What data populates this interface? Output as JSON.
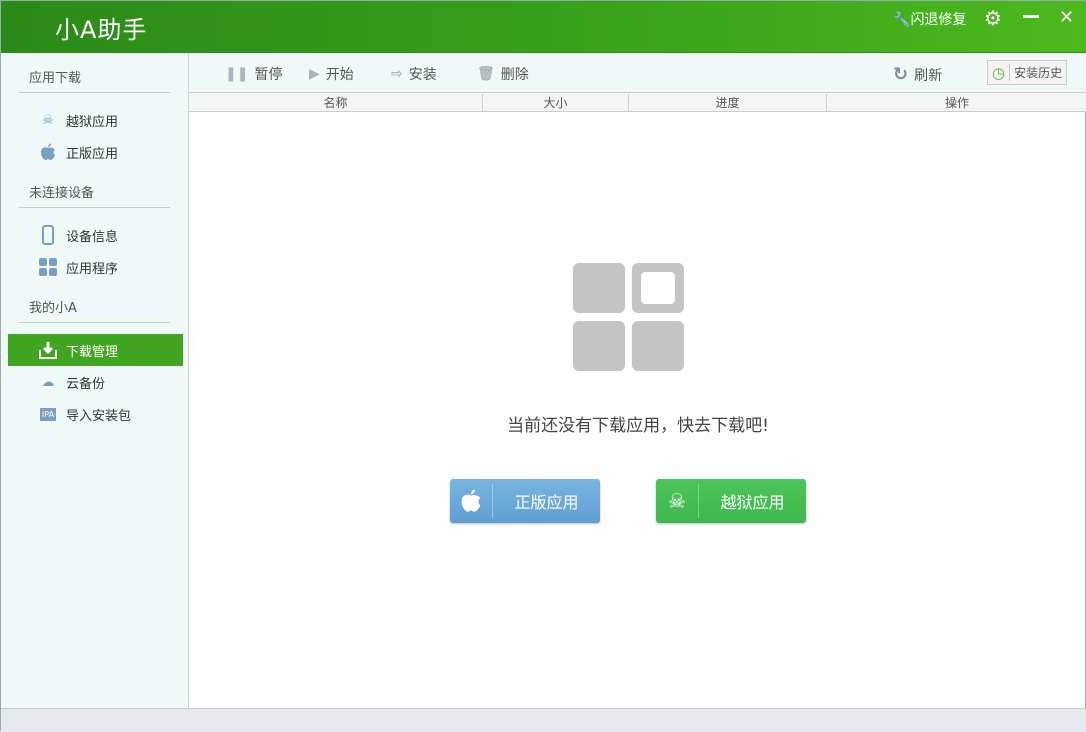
{
  "app": {
    "title": "小A助手",
    "repair": "闪退修复"
  },
  "sidebar": {
    "sections": [
      {
        "label": "应用下载",
        "items": [
          {
            "label": "越狱应用",
            "icon": "jailbreak-apple-icon"
          },
          {
            "label": "正版应用",
            "icon": "apple-icon"
          }
        ]
      },
      {
        "label": "未连接设备",
        "items": [
          {
            "label": "设备信息",
            "icon": "phone-icon"
          },
          {
            "label": "应用程序",
            "icon": "apps-grid-icon"
          }
        ]
      },
      {
        "label": "我的小A",
        "items": [
          {
            "label": "下载管理",
            "icon": "download-icon",
            "active": true
          },
          {
            "label": "云备份",
            "icon": "cloud-upload-icon"
          },
          {
            "label": "导入安装包",
            "icon": "ipa-icon",
            "badge": "IPA"
          }
        ]
      }
    ]
  },
  "toolbar": {
    "pause": "暂停",
    "start": "开始",
    "install": "安装",
    "delete": "删除",
    "refresh": "刷新",
    "history": "安装历史"
  },
  "table": {
    "columns": [
      "名称",
      "大小",
      "进度",
      "操作"
    ]
  },
  "empty": {
    "message": "当前还没有下载应用，快去下载吧!",
    "official_button": "正版应用",
    "jailbreak_button": "越狱应用"
  },
  "colors": {
    "accent": "#40a520",
    "blue_button": "#6aa8d8",
    "green_button": "#45bd55"
  }
}
